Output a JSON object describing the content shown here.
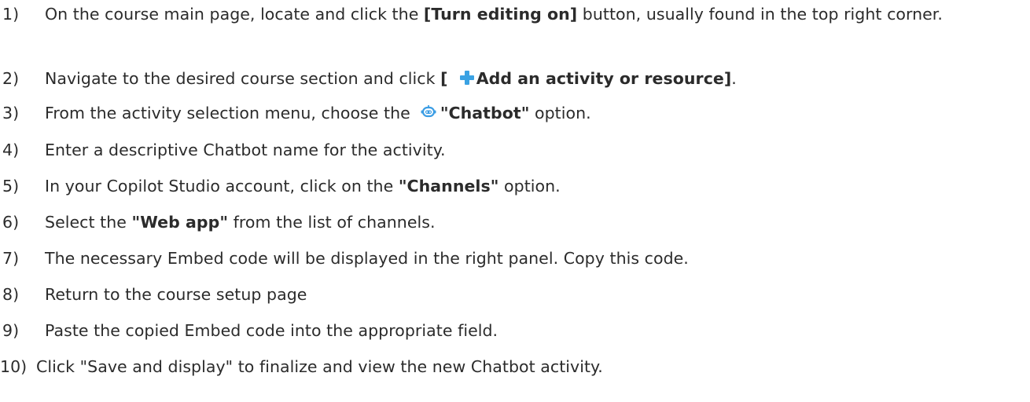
{
  "steps": [
    {
      "num": "1)",
      "before": "On the course main page, locate and click the ",
      "bold": "[Turn editing on]",
      "after": " button, usually found in the top right corner."
    },
    {
      "num": "2)",
      "before": "Navigate to the desired course section and click ",
      "bold_open": "[ ",
      "icon": "plus-icon",
      "bold": "Add an activity or resource]",
      "after": "."
    },
    {
      "num": "3)",
      "before": "From the activity selection menu, choose the",
      "icon": "chatbot-icon",
      "bold": "\"Chatbot\"",
      "after": " option."
    },
    {
      "num": "4)",
      "text": "Enter a descriptive Chatbot name for the activity."
    },
    {
      "num": "5)",
      "before": "In your Copilot Studio account, click on the ",
      "bold": "\"Channels\"",
      "after": " option."
    },
    {
      "num": "6)",
      "before": "Select the ",
      "bold": "\"Web app\"",
      "after": " from the list of channels."
    },
    {
      "num": "7)",
      "text": "The necessary Embed code will be displayed in the right panel. Copy this code."
    },
    {
      "num": "8)",
      "text": "Return to the course setup page"
    },
    {
      "num": "9)",
      "text": "Paste the copied Embed code into the appropriate field."
    },
    {
      "num": "10)",
      "text": "Click \"Save and display\" to finalize and view the new Chatbot activity."
    }
  ],
  "colors": {
    "text": "#2b2b2b",
    "plus_icon": "#3aa2e3",
    "chatbot_icon": "#3b9de4"
  }
}
